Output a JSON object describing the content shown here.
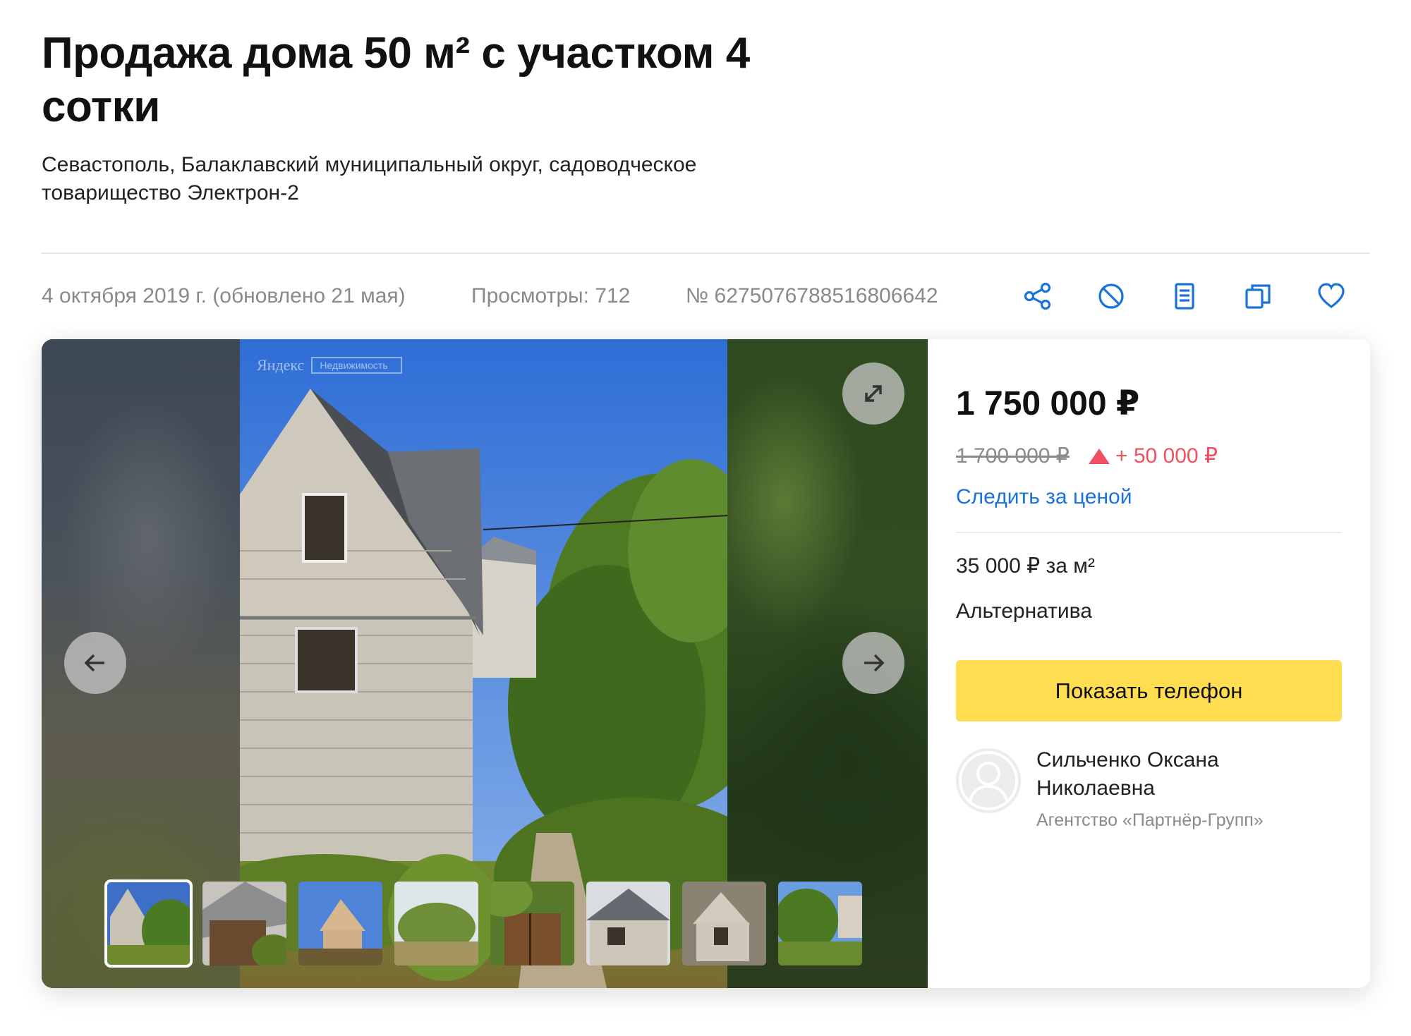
{
  "listing": {
    "title": "Продажа дома 50 м² с участком 4 сотки",
    "address": "Севастополь, Балаклавский муниципальный округ, садоводческое товарищество Электрон-2"
  },
  "meta": {
    "date": "4 октября 2019 г. (обновлено 21 мая)",
    "views": "Просмотры: 712",
    "number": "№ 6275076788516806642"
  },
  "actions": [
    {
      "name": "share",
      "icon": "share-icon"
    },
    {
      "name": "hide",
      "icon": "block-icon"
    },
    {
      "name": "report",
      "icon": "document-icon"
    },
    {
      "name": "compare",
      "icon": "copy-icon"
    },
    {
      "name": "favorite",
      "icon": "heart-icon"
    }
  ],
  "gallery": {
    "watermark_brand": "Яндекс",
    "watermark_tag": "Недвижимость",
    "thumbnail_count": 8,
    "active_thumbnail": 1
  },
  "offer": {
    "price": "1 750 000 ₽",
    "old_price": "1 700 000 ₽",
    "price_change": "+ 50 000 ₽",
    "watch_price_link": "Следить за ценой",
    "price_per_m2": "35 000 ₽ за м²",
    "deal_type": "Альтернатива",
    "show_phone_button": "Показать телефон"
  },
  "agent": {
    "name": "Сильченко Оксана Николаевна",
    "agency": "Агентство «Партнёр-Групп»"
  },
  "colors": {
    "accent_link": "#1a73d9",
    "button_yellow": "#ffdd50",
    "price_up_red": "#f0505f"
  }
}
